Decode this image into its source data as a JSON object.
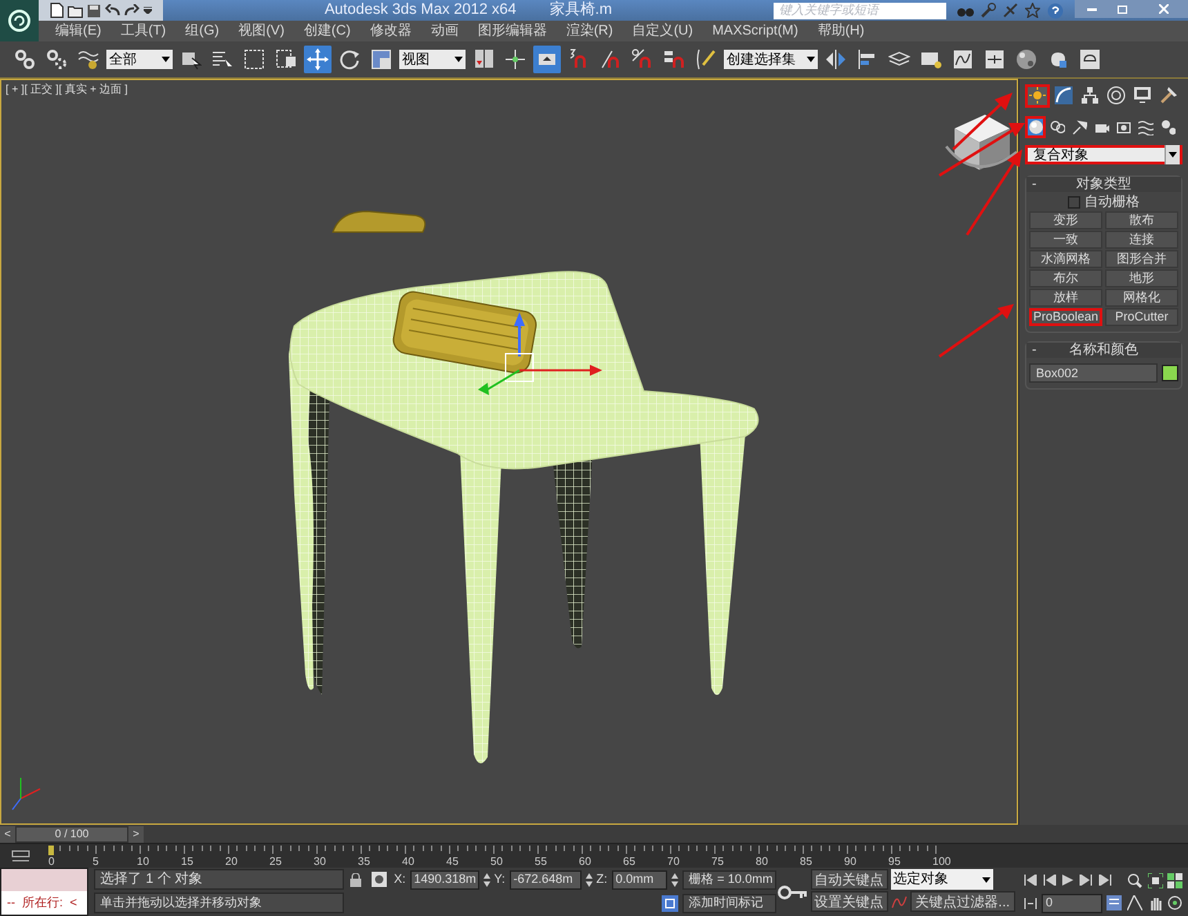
{
  "window": {
    "title": "Autodesk 3ds Max  2012 x64",
    "document": "家具椅.m",
    "search_placeholder": "键入关键字或短语"
  },
  "menu": [
    "编辑(E)",
    "工具(T)",
    "组(G)",
    "视图(V)",
    "创建(C)",
    "修改器",
    "动画",
    "图形编辑器",
    "渲染(R)",
    "自定义(U)",
    "MAXScript(M)",
    "帮助(H)"
  ],
  "toolbar": [
    {
      "kind": "tool",
      "selected": false
    },
    {
      "kind": "tool",
      "selected": false
    },
    {
      "kind": "tool",
      "selected": false
    },
    {
      "kind": "dropdown",
      "value": "全部"
    },
    {
      "kind": "tool",
      "selected": false
    },
    {
      "kind": "tool",
      "selected": false
    },
    {
      "kind": "tool",
      "selected": false
    },
    {
      "kind": "tool",
      "selected": false
    },
    {
      "kind": "tool",
      "selected": true
    },
    {
      "kind": "tool",
      "selected": false
    },
    {
      "kind": "tool",
      "selected": false
    },
    {
      "kind": "dropdown",
      "value": "视图"
    },
    {
      "kind": "tool",
      "selected": false
    },
    {
      "kind": "tool",
      "selected": false
    },
    {
      "kind": "tool",
      "selected": true
    },
    {
      "kind": "tool",
      "selected": false
    },
    {
      "kind": "tool",
      "selected": false
    },
    {
      "kind": "tool",
      "selected": false
    },
    {
      "kind": "tool",
      "selected": false
    },
    {
      "kind": "tool",
      "selected": false
    },
    {
      "kind": "dropdown",
      "value": "创建选择集"
    },
    {
      "kind": "tool",
      "selected": false
    },
    {
      "kind": "tool",
      "selected": false
    },
    {
      "kind": "tool",
      "selected": false
    },
    {
      "kind": "tool",
      "selected": false
    },
    {
      "kind": "tool",
      "selected": false
    },
    {
      "kind": "tool",
      "selected": false
    },
    {
      "kind": "tool",
      "selected": false
    },
    {
      "kind": "tool",
      "selected": false
    },
    {
      "kind": "tool",
      "selected": false
    }
  ],
  "viewport": {
    "label": "[ + ][ 正交 ][ 真实 + 边面 ]"
  },
  "command_panel": {
    "tabs": [
      {
        "selected": true,
        "highlighted": true
      },
      {
        "selected": false,
        "highlighted": false
      },
      {
        "selected": false,
        "highlighted": false
      },
      {
        "selected": false,
        "highlighted": false
      },
      {
        "selected": false,
        "highlighted": false
      },
      {
        "selected": false,
        "highlighted": false
      }
    ],
    "categories": [
      {
        "selected": true,
        "highlighted": true
      },
      {
        "selected": false,
        "highlighted": false
      },
      {
        "selected": false,
        "highlighted": false
      },
      {
        "selected": false,
        "highlighted": false
      },
      {
        "selected": false,
        "highlighted": false
      },
      {
        "selected": false,
        "highlighted": false
      },
      {
        "selected": false,
        "highlighted": false
      }
    ],
    "dropdown": {
      "value": "复合对象",
      "highlighted": true
    },
    "object_type": {
      "title": "对象类型",
      "collapse": "-",
      "autogrid": {
        "label": "自动栅格",
        "checked": false
      },
      "buttons": [
        {
          "label": "变形",
          "highlighted": false
        },
        {
          "label": "散布",
          "highlighted": false
        },
        {
          "label": "一致",
          "highlighted": false
        },
        {
          "label": "连接",
          "highlighted": false
        },
        {
          "label": "水滴网格",
          "highlighted": false
        },
        {
          "label": "图形合并",
          "highlighted": false
        },
        {
          "label": "布尔",
          "highlighted": false
        },
        {
          "label": "地形",
          "highlighted": false
        },
        {
          "label": "放样",
          "highlighted": false
        },
        {
          "label": "网格化",
          "highlighted": false
        },
        {
          "label": "ProBoolean",
          "highlighted": true
        },
        {
          "label": "ProCutter",
          "highlighted": false
        }
      ]
    },
    "name_color": {
      "title": "名称和颜色",
      "collapse": "-",
      "name": "Box002",
      "color": "#8ad84e"
    }
  },
  "timeline": {
    "prev": "<",
    "position": "0 / 100",
    "next": ">",
    "ticks": [
      "0",
      "5",
      "10",
      "15",
      "20",
      "25",
      "30",
      "35",
      "40",
      "45",
      "50",
      "55",
      "60",
      "65",
      "70",
      "75",
      "80",
      "85",
      "90",
      "95",
      "100"
    ]
  },
  "status": {
    "script_line": "--  所在行:  <",
    "prompt": "选择了 1 个 对象",
    "hint": "单击并拖动以选择并移动对象",
    "x_label": "X:",
    "x": "1490.318m",
    "y_label": "Y:",
    "y": "-672.648m",
    "z_label": "Z:",
    "z": "0.0mm",
    "grid": "栅格 = 10.0mm",
    "add_time_tag": "添加时间标记",
    "auto_key": "自动关键点",
    "set_key": "设置关键点",
    "key_target": "选定对象",
    "key_filters": "关键点过滤器...",
    "frame": "0"
  }
}
